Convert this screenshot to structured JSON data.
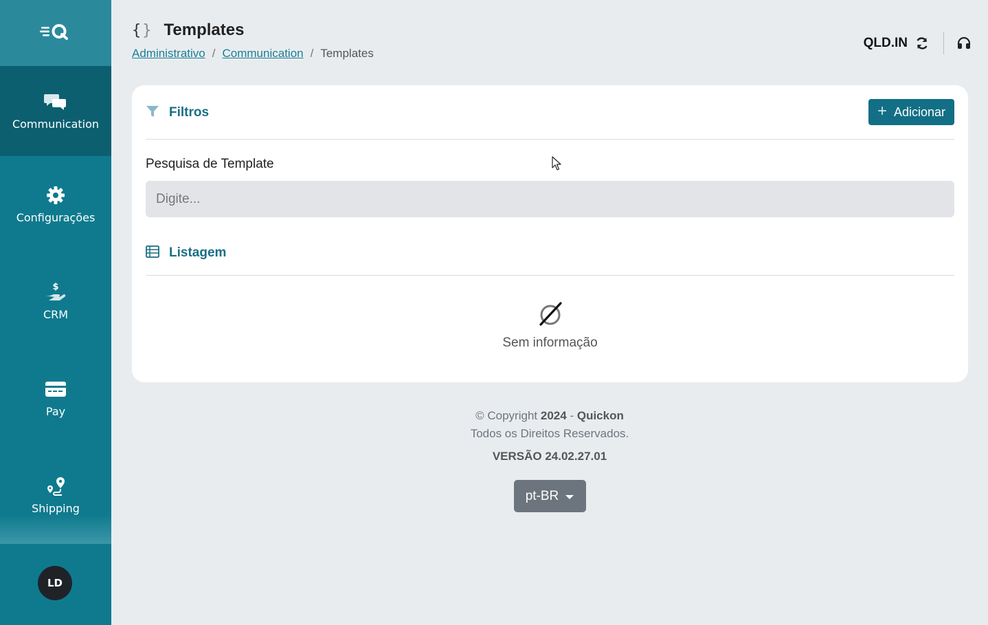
{
  "sidebar": {
    "logo_icon": "quickon-logo-icon",
    "items": [
      {
        "label": "Communication",
        "icon": "chat-bubbles-icon",
        "active": true
      },
      {
        "label": "Configurações",
        "icon": "gear-icon"
      },
      {
        "label": "CRM",
        "icon": "hand-dollar-icon"
      },
      {
        "label": "Pay",
        "icon": "card-icon"
      },
      {
        "label": "Shipping",
        "icon": "route-pin-icon"
      }
    ],
    "avatar": "LD"
  },
  "header": {
    "title": "Templates",
    "breadcrumb": [
      {
        "label": "Administrativo",
        "link": true
      },
      {
        "label": "Communication",
        "link": true
      },
      {
        "label": "Templates",
        "link": false
      }
    ],
    "org_name": "QLD.IN"
  },
  "filters": {
    "title": "Filtros",
    "add_label": "Adicionar",
    "search_label": "Pesquisa de Template",
    "search_placeholder": "Digite...",
    "search_value": ""
  },
  "listing": {
    "title": "Listagem",
    "empty_text": "Sem informação"
  },
  "footer": {
    "copyright_prefix": "© Copyright",
    "year": "2024",
    "dash": "-",
    "brand": "Quickon",
    "rights": "Todos os Direitos Reservados.",
    "version": "VERSÃO 24.02.27.01",
    "language": "pt-BR"
  },
  "colors": {
    "sidebar": "#0f7a8e",
    "sidebar_active": "#0b5f6f",
    "accent": "#126f85",
    "background": "#e9ecef"
  }
}
